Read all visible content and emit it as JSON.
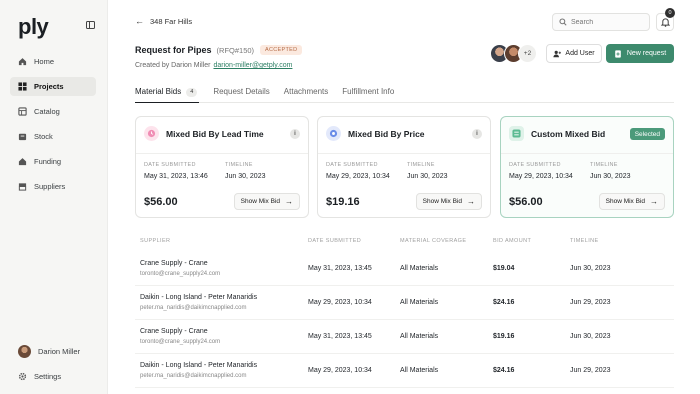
{
  "app": {
    "logo": "ply"
  },
  "sidebar": {
    "items": [
      {
        "label": "Home",
        "icon": "home-icon",
        "active": false
      },
      {
        "label": "Projects",
        "icon": "grid-icon",
        "active": true
      },
      {
        "label": "Catalog",
        "icon": "catalog-icon",
        "active": false
      },
      {
        "label": "Stock",
        "icon": "stock-icon",
        "active": false
      },
      {
        "label": "Funding",
        "icon": "funding-icon",
        "active": false
      },
      {
        "label": "Suppliers",
        "icon": "suppliers-icon",
        "active": false
      }
    ],
    "user": {
      "name": "Darion Miller"
    },
    "settings_label": "Settings"
  },
  "topbar": {
    "breadcrumb": "348 Far Hills",
    "search_placeholder": "Search",
    "notifications_count": "0"
  },
  "header": {
    "title": "Request for Pipes",
    "rfq": "(RFQ#150)",
    "status": "ACCEPTED",
    "created_prefix": "Created by Darion Miller",
    "created_email": "darion-miller@getply.com",
    "avatars_more": "+2",
    "add_user_label": "Add User",
    "new_request_label": "New request"
  },
  "tabs": [
    {
      "label": "Material Bids",
      "count": "4",
      "active": true
    },
    {
      "label": "Request Details",
      "active": false
    },
    {
      "label": "Attachments",
      "active": false
    },
    {
      "label": "Fulfillment Info",
      "active": false
    }
  ],
  "cards": [
    {
      "title": "Mixed Bid By Lead Time",
      "date_label": "DATE SUBMITTED",
      "date": "May 31, 2023, 13:46",
      "timeline_label": "TIMELINE",
      "timeline": "Jun 30, 2023",
      "price": "$56.00",
      "button": "Show Mix Bid",
      "icon_color": "#f08db4",
      "selected": false
    },
    {
      "title": "Mixed Bid By Price",
      "date_label": "DATE SUBMITTED",
      "date": "May 29, 2023, 10:34",
      "timeline_label": "TIMELINE",
      "timeline": "Jun 30, 2023",
      "price": "$19.16",
      "button": "Show Mix Bid",
      "icon_color": "#6b8de8",
      "selected": false
    },
    {
      "title": "Custom Mixed Bid",
      "date_label": "DATE SUBMITTED",
      "date": "May 29, 2023, 10:34",
      "timeline_label": "TIMELINE",
      "timeline": "Jun 30, 2023",
      "price": "$56.00",
      "button": "Show Mix Bid",
      "icon_color": "#5dbb93",
      "selected": true,
      "selected_label": "Selected"
    }
  ],
  "table": {
    "headers": [
      "SUPPLIER",
      "DATE SUBMITTED",
      "MATERIAL COVERAGE",
      "BID AMOUNT",
      "TIMELINE"
    ],
    "rows": [
      {
        "supplier": "Crane Supply - Crane",
        "email": "toronto@crane_supply24.com",
        "date": "May 31, 2023, 13:45",
        "coverage": "All Materials",
        "amount": "$19.04",
        "timeline": "Jun 30, 2023"
      },
      {
        "supplier": "Daikin - Long Island - Peter Manaridis",
        "email": "peter.ma_naridis@daikimcnapplied.com",
        "date": "May 29, 2023, 10:34",
        "coverage": "All Materials",
        "amount": "$24.16",
        "timeline": "Jun 29, 2023"
      },
      {
        "supplier": "Crane Supply - Crane",
        "email": "toronto@crane_supply24.com",
        "date": "May 31, 2023, 13:45",
        "coverage": "All Materials",
        "amount": "$19.16",
        "timeline": "Jun 30, 2023"
      },
      {
        "supplier": "Daikin - Long Island - Peter Manaridis",
        "email": "peter.ma_naridis@daikimcnapplied.com",
        "date": "May 29, 2023, 10:34",
        "coverage": "All Materials",
        "amount": "$24.16",
        "timeline": "Jun 29, 2023"
      }
    ]
  },
  "colors": {
    "accent": "#3d8a6d",
    "status_bg": "#fbe9df",
    "status_fg": "#b56b45"
  }
}
